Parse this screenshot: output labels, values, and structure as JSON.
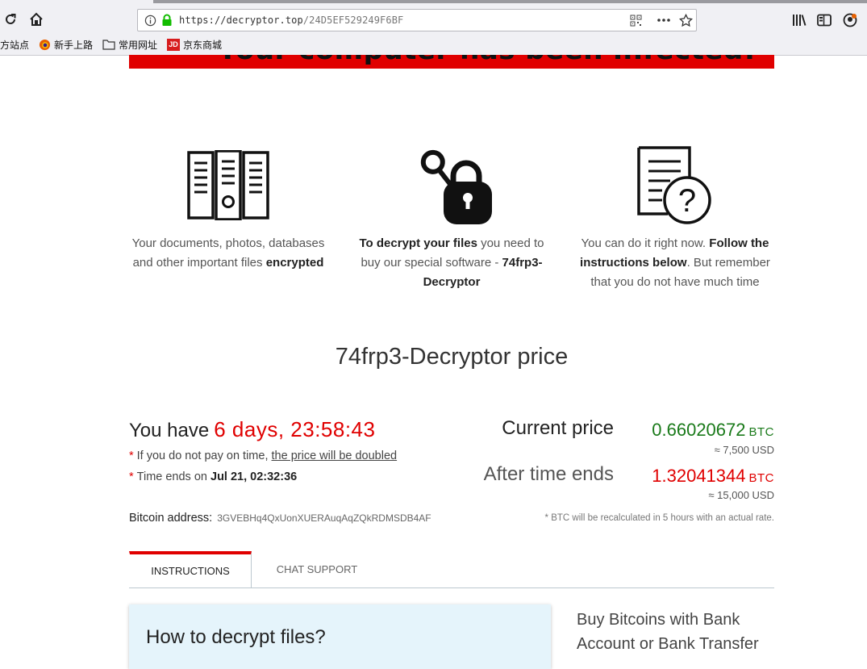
{
  "browser": {
    "url_domain": "https://decryptor.top",
    "url_path": "/24D5EF529249F6BF",
    "bookmarks": [
      {
        "label": "方站点",
        "icon": "none"
      },
      {
        "label": "新手上路",
        "icon": "firefox-icon"
      },
      {
        "label": "常用网址",
        "icon": "folder-icon"
      },
      {
        "label": "京东商城",
        "icon": "jd-icon",
        "badge": "JD"
      }
    ]
  },
  "banner": {
    "text": "Your computer has been infected!"
  },
  "features": [
    {
      "pre": "Your documents, photos, databases and other important files ",
      "bold": "encrypted",
      "post": ""
    },
    {
      "bold": "To decrypt your files",
      "post": " you need to buy our special software - ",
      "bold2": "74frp3-Decryptor"
    },
    {
      "pre": "You can do it right now. ",
      "bold": "Follow the instructions below",
      "post": ". But remember that you do not have much time"
    }
  ],
  "price": {
    "title": "74frp3-Decryptor price",
    "you_have": "You have",
    "timer": "6 days, 23:58:43",
    "note1_pre": "If you do not pay on time, ",
    "note1_link": "the price will be doubled",
    "note2_pre": "Time ends on ",
    "note2_date": "Jul 21, 02:32:36",
    "current_label": "Current price",
    "current_btc": "0.66020672",
    "current_usd": "≈ 7,500 USD",
    "after_label": "After time ends",
    "after_btc": "1.32041344",
    "after_usd": "≈ 15,000 USD",
    "btc_unit": "BTC",
    "address_label": "Bitcoin address:",
    "address": "3GVEBHq4QxUonXUERAuqAqZQkRDMSDB4AF",
    "recalc_note": "* BTC will be recalculated in 5 hours with an actual rate.",
    "asterisk": "*"
  },
  "tabs": [
    "INSTRUCTIONS",
    "CHAT SUPPORT"
  ],
  "instructions": {
    "title": "How to decrypt files?",
    "side": "Buy Bitcoins with Bank Account or Bank Transfer"
  },
  "colors": {
    "accent_red": "#e00000",
    "price_green": "#1a7a1a",
    "info_bg": "#e5f4fb"
  }
}
